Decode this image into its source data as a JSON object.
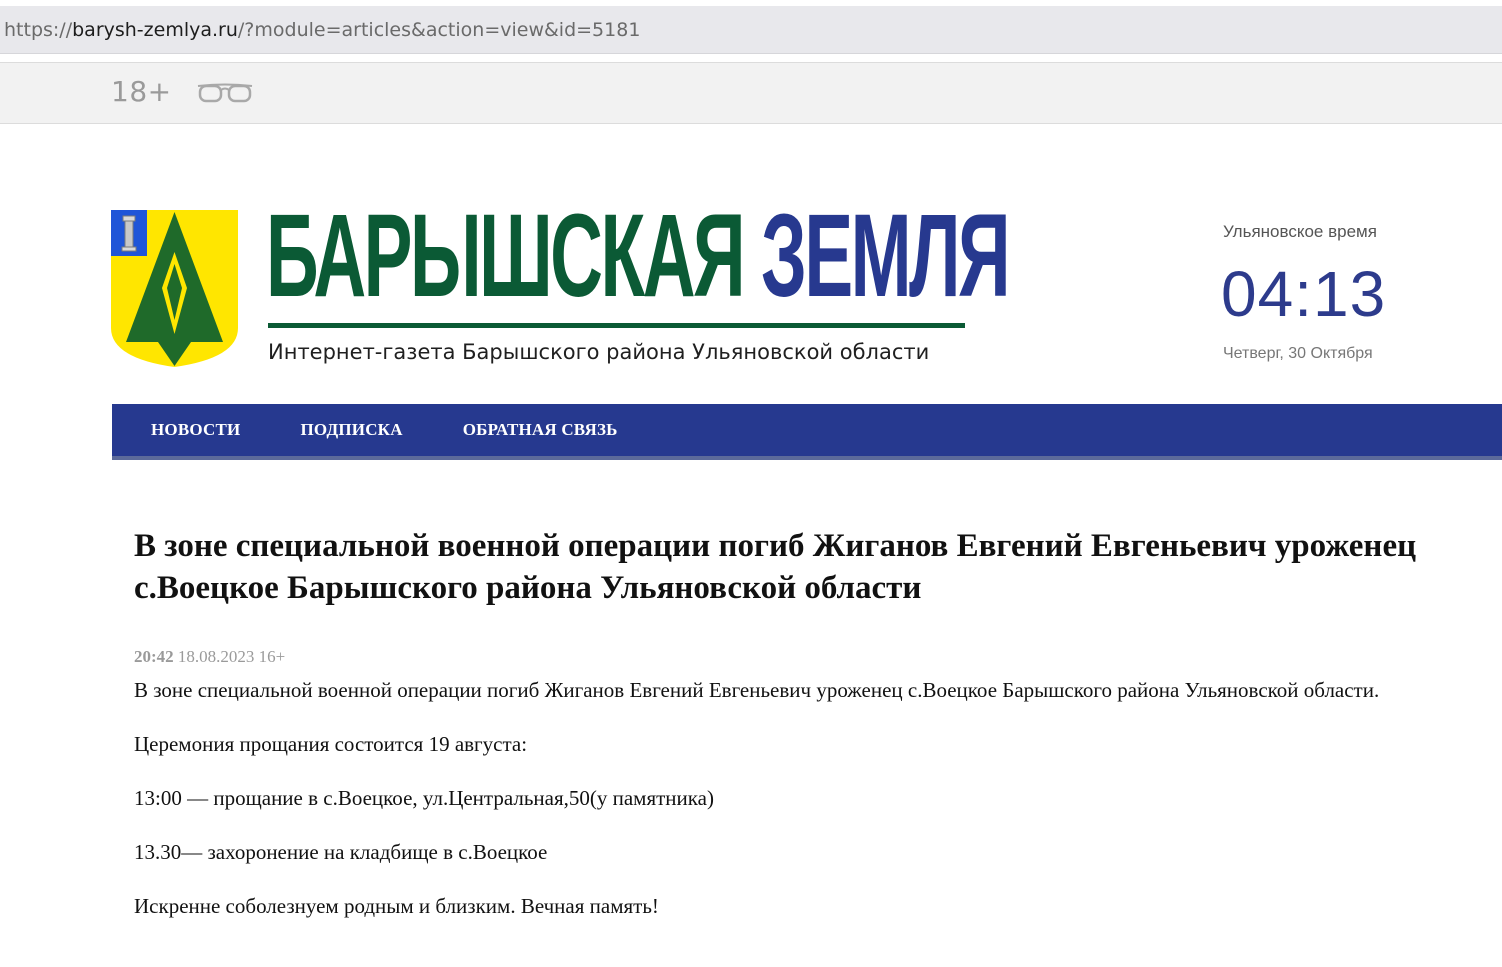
{
  "browser": {
    "url_scheme": "https://",
    "url_host": "barysh-zemlya.ru",
    "url_path": "/?module=articles&action=view&id=5181"
  },
  "topbar": {
    "age_rating": "18+",
    "accessibility_icon": "glasses-icon"
  },
  "header": {
    "logo_icon": "coat-of-arms-emblem",
    "title_word1": "БАРЫШСКАЯ",
    "title_word2": "ЗЕМЛЯ",
    "subtitle": "Интернет-газета Барышского района Ульяновской области",
    "clock": {
      "label": "Ульяновское время",
      "time": "04:13",
      "date": "Четверг, 30 Октября"
    }
  },
  "nav": {
    "items": [
      {
        "label": "НОВОСТИ"
      },
      {
        "label": "ПОДПИСКА"
      },
      {
        "label": "ОБРАТНАЯ СВЯЗЬ"
      }
    ]
  },
  "article": {
    "title": "В зоне специальной военной операции погиб Жиганов Евгений Евгеньевич уроженец с.Воецкое Барышского района Ульяновской области",
    "time": "20:42",
    "date": "18.08.2023",
    "age_rating": "16+",
    "paragraphs": [
      "В зоне специальной военной операции погиб Жиганов Евгений Евгеньевич уроженец с.Воецкое Барышского района Ульяновской области.",
      "Церемония прощания состоится 19 августа:",
      "13:00 — прощание в с.Воецкое, ул.Центральная,50(у памятника)",
      "13.30— захоронение на кладбище в с.Воецкое",
      "Искренне соболезнуем родным и близким. Вечная память!"
    ]
  },
  "colors": {
    "brand_green": "#0b5a35",
    "brand_blue": "#27398f",
    "nav_bg": "#26398f",
    "emblem_yellow": "#ffe600",
    "emblem_blue": "#1f55d8"
  }
}
